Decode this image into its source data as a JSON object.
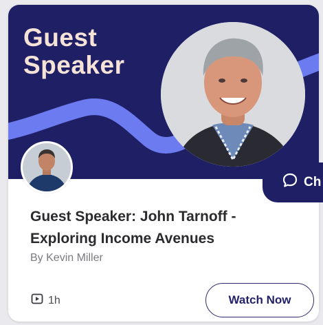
{
  "banner": {
    "title_line1": "Guest",
    "title_line2": "Speaker",
    "background_color": "#1f1f66",
    "title_color": "#f6e3d8",
    "wave_color": "#6c7cf0"
  },
  "chat": {
    "label": "Ch",
    "icon": "chat-bubble-icon"
  },
  "event": {
    "title": "Guest Speaker: John Tarnoff - Exploring Income Avenues",
    "byline": "By Kevin Miller",
    "duration": "1h",
    "duration_icon": "video-play-icon"
  },
  "actions": {
    "watch_label": "Watch Now",
    "accent_color": "#23236a"
  }
}
